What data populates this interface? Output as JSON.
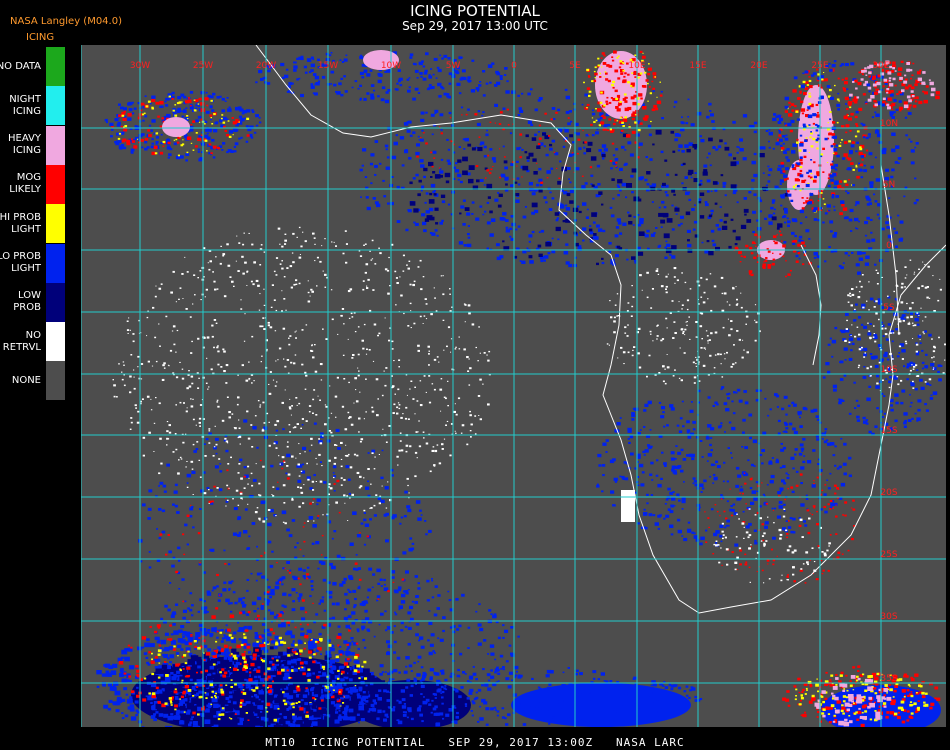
{
  "header": {
    "source": "NASA Langley (M04.0)",
    "product": "ICING",
    "title": "ICING POTENTIAL",
    "datetime": "Sep 29, 2017 13:00 UTC"
  },
  "legend": [
    {
      "lines": [
        "NO DATA"
      ],
      "color": "#1ca81c"
    },
    {
      "lines": [
        "NIGHT",
        "ICING"
      ],
      "color": "#22eeee"
    },
    {
      "lines": [
        "HEAVY",
        "ICING"
      ],
      "color": "#f0a8e0"
    },
    {
      "lines": [
        "MOG",
        "LIKELY"
      ],
      "color": "#ff0000"
    },
    {
      "lines": [
        "HI PROB",
        "LIGHT"
      ],
      "color": "#ffff00"
    },
    {
      "lines": [
        "LO PROB",
        "LIGHT"
      ],
      "color": "#0022ee"
    },
    {
      "lines": [
        "LOW",
        "PROB"
      ],
      "color": "#00007a"
    },
    {
      "lines": [
        "NO",
        "RETRVL"
      ],
      "color": "#ffffff"
    },
    {
      "lines": [
        "NONE"
      ],
      "color": "#4d4d4d"
    }
  ],
  "map": {
    "background_color": "#4d4d4d",
    "grid_color": "#22cccc",
    "coastline_color": "#ffffff",
    "label_color": "#ff2020",
    "longitude_labels": [
      "30W",
      "25W",
      "20W",
      "15W",
      "10W",
      "5W",
      "0",
      "5E",
      "10E",
      "15E",
      "20E",
      "25E",
      "30E"
    ],
    "latitude_labels": [
      "10N",
      "5N",
      "0",
      "5S",
      "10S",
      "15S",
      "20S",
      "25S",
      "30S",
      "35S"
    ]
  },
  "footer": "MT10  ICING POTENTIAL   SEP 29, 2017 13:00Z   NASA LARC"
}
